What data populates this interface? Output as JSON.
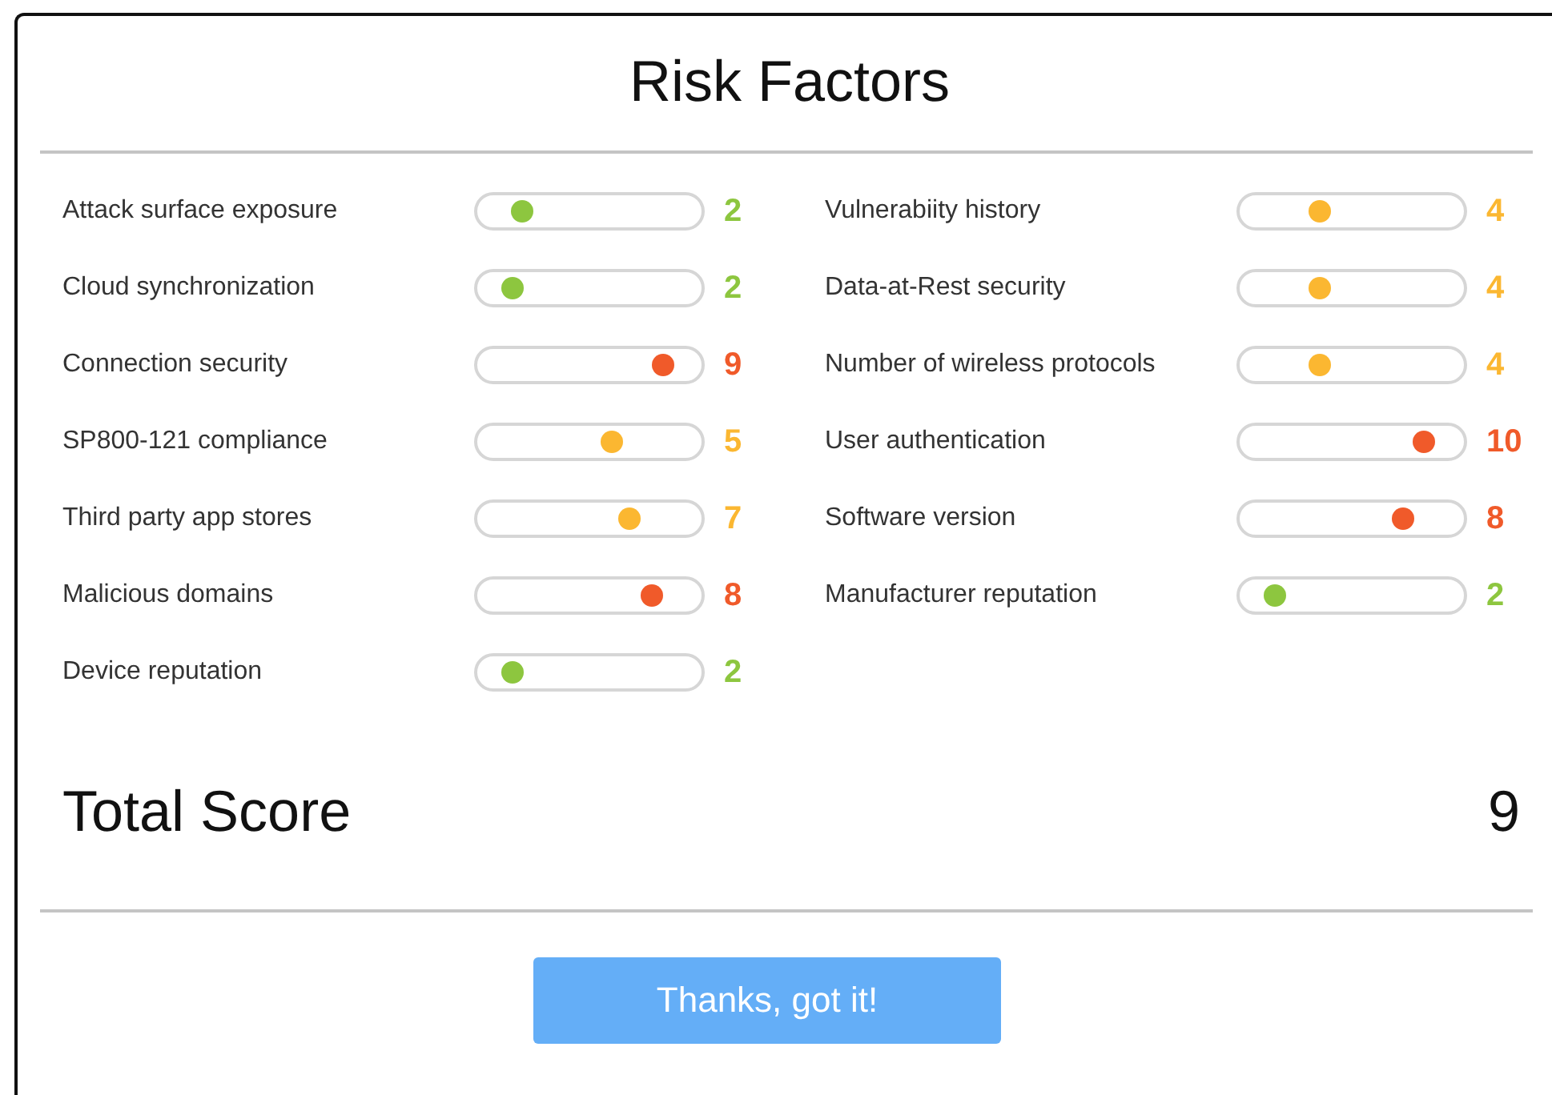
{
  "title": "Risk Factors",
  "factors": [
    {
      "label": "Attack surface exposure",
      "level": 0.2,
      "score": "2",
      "color": "#8dc63f"
    },
    {
      "label": "Cloud synchronization",
      "level": 0.16,
      "score": "2",
      "color": "#8dc63f"
    },
    {
      "label": "Connection security",
      "level": 0.83,
      "score": "9",
      "color": "#f05a2a"
    },
    {
      "label": "SP800-121 compliance",
      "level": 0.6,
      "score": "5",
      "color": "#fbb731"
    },
    {
      "label": "Third party app stores",
      "level": 0.68,
      "score": "7",
      "color": "#fbb731"
    },
    {
      "label": "Malicious domains",
      "level": 0.78,
      "score": "8",
      "color": "#f05a2a"
    },
    {
      "label": "Device reputation",
      "level": 0.16,
      "score": "2",
      "color": "#8dc63f"
    },
    {
      "label": "Vulnerabiity history",
      "level": 0.36,
      "score": "4",
      "color": "#fbb731"
    },
    {
      "label": "Data-at-Rest security",
      "level": 0.36,
      "score": "4",
      "color": "#fbb731"
    },
    {
      "label": "Number of wireless protocols",
      "level": 0.36,
      "score": "4",
      "color": "#fbb731"
    },
    {
      "label": "User authentication",
      "level": 0.82,
      "score": "10",
      "color": "#f05a2a"
    },
    {
      "label": "Software version",
      "level": 0.73,
      "score": "8",
      "color": "#f05a2a"
    },
    {
      "label": "Manufacturer reputation",
      "level": 0.16,
      "score": "2",
      "color": "#8dc63f"
    }
  ],
  "total": {
    "label": "Total Score",
    "value": "9"
  },
  "button": "Thanks, got it!"
}
